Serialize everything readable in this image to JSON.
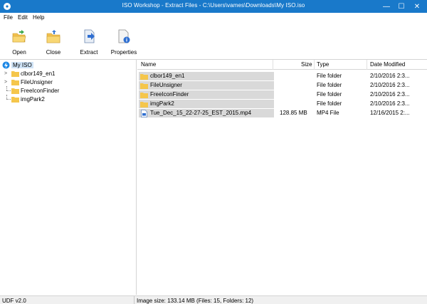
{
  "window": {
    "title": "ISO Workshop - Extract Files - C:\\Users\\vames\\Downloads\\My ISO.iso",
    "minimize": "—",
    "maximize": "☐",
    "close": "✕"
  },
  "menu": [
    "File",
    "Edit",
    "Help"
  ],
  "toolbar": [
    {
      "label": "Open",
      "icon": "open-folder-icon"
    },
    {
      "label": "Close",
      "icon": "close-folder-icon"
    },
    {
      "label": "Extract",
      "icon": "extract-icon"
    },
    {
      "label": "Properties",
      "icon": "properties-icon"
    }
  ],
  "tree": {
    "root": "My ISO",
    "children": [
      "clbor149_en1",
      "FileUnsigner",
      "FreeIconFinder",
      "imgPark2"
    ]
  },
  "list": {
    "columns": {
      "name": "Name",
      "size": "Size",
      "type": "Type",
      "date": "Date Modified"
    },
    "rows": [
      {
        "name": "clbor149_en1",
        "size": "",
        "type": "File folder",
        "date": "2/10/2016 2:3..."
      },
      {
        "name": "FileUnsigner",
        "size": "",
        "type": "File folder",
        "date": "2/10/2016 2:3..."
      },
      {
        "name": "FreeIconFinder",
        "size": "",
        "type": "File folder",
        "date": "2/10/2016 2:3..."
      },
      {
        "name": "imgPark2",
        "size": "",
        "type": "File folder",
        "date": "2/10/2016 2:3..."
      },
      {
        "name": "Tue_Dec_15_22-27-25_EST_2015.mp4",
        "size": "128.85 MB",
        "type": "MP4 File",
        "date": "12/16/2015 2:..."
      }
    ]
  },
  "status": {
    "format": "UDF v2.0",
    "info": "Image size: 133.14 MB (Files: 15, Folders: 12)"
  },
  "colors": {
    "titlebar": "#1979ca",
    "folder": "#f5c64b",
    "selection": "#d9d9d9"
  }
}
